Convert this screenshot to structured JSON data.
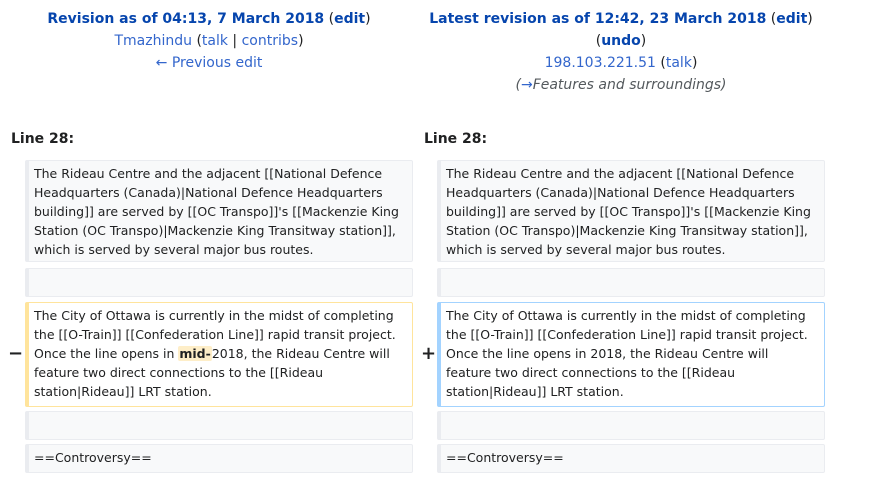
{
  "left": {
    "title": "Revision as of 04:13, 7 March 2018",
    "edit": "edit",
    "user": "Tmazhindu",
    "talk": "talk",
    "contribs": "contribs",
    "prev": "← Previous edit"
  },
  "right": {
    "title": "Latest revision as of 12:42, 23 March 2018",
    "edit": "edit",
    "undo": "undo",
    "user": "198.103.221.51",
    "talk": "talk",
    "summary_arrow": "→",
    "summary": "Features and surroundings"
  },
  "line_label": "Line 28:",
  "context1": "The Rideau Centre and the adjacent [[National Defence Headquarters (Canada)|National Defence Headquarters building]] are served by [[OC Transpo]]'s [[Mackenzie King Station (OC Transpo)|Mackenzie King Transitway station]], which is served by several major bus routes.",
  "removed": {
    "before": "The City of Ottawa is currently in the midst of completing the [[O-Train]] [[Confederation Line]] rapid transit project. Once the line opens in ",
    "changed": "mid-",
    "after": "2018, the Rideau Centre will feature two direct connections to the [[Rideau station|Rideau]] LRT station."
  },
  "added": "The City of Ottawa is currently in the midst of completing the [[O-Train]] [[Confederation Line]] rapid transit project. Once the line opens in 2018, the Rideau Centre will feature two direct connections to the [[Rideau station|Rideau]] LRT station.",
  "context3": "==Controversy==",
  "marker_minus": "−",
  "marker_plus": "+"
}
